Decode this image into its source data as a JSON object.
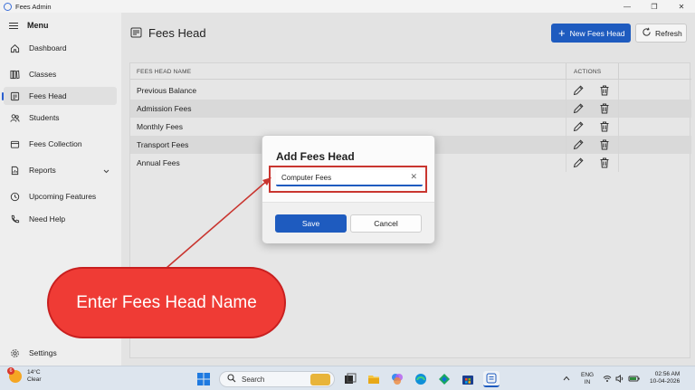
{
  "window": {
    "title": "Fees Admin"
  },
  "sidebar": {
    "menu_label": "Menu",
    "items": [
      {
        "label": "Dashboard",
        "icon": "home-icon"
      },
      {
        "label": "Classes",
        "icon": "books-icon"
      },
      {
        "label": "Fees Head",
        "icon": "document-icon",
        "active": true
      },
      {
        "label": "Students",
        "icon": "people-icon"
      },
      {
        "label": "Fees Collection",
        "icon": "wallet-icon"
      },
      {
        "label": "Reports",
        "icon": "report-icon"
      },
      {
        "label": "Upcoming Features",
        "icon": "clock-icon"
      },
      {
        "label": "Need Help",
        "icon": "phone-icon"
      }
    ],
    "settings_label": "Settings"
  },
  "header": {
    "title": "Fees Head",
    "new_button": "New Fees Head",
    "refresh_button": "Refresh"
  },
  "table": {
    "columns": [
      "FEES HEAD NAME",
      "ACTIONS"
    ],
    "rows": [
      "Previous Balance",
      "Admission Fees",
      "Monthly Fees",
      "Transport Fees",
      "Annual Fees"
    ]
  },
  "modal": {
    "title": "Add Fees Head",
    "input_value": "Computer Fees",
    "save_label": "Save",
    "cancel_label": "Cancel"
  },
  "callout": {
    "text": "Enter Fees Head Name"
  },
  "taskbar": {
    "temperature": "14°C",
    "weather": "Clear",
    "weather_badge": "6",
    "search_label": "Search",
    "lang_top": "ENG",
    "lang_bottom": "IN",
    "time": "02:56 AM",
    "date": "10-04-2026"
  },
  "colors": {
    "accent": "#1e5bbf",
    "callout": "#ef3b35",
    "highlight": "#c9352f"
  }
}
